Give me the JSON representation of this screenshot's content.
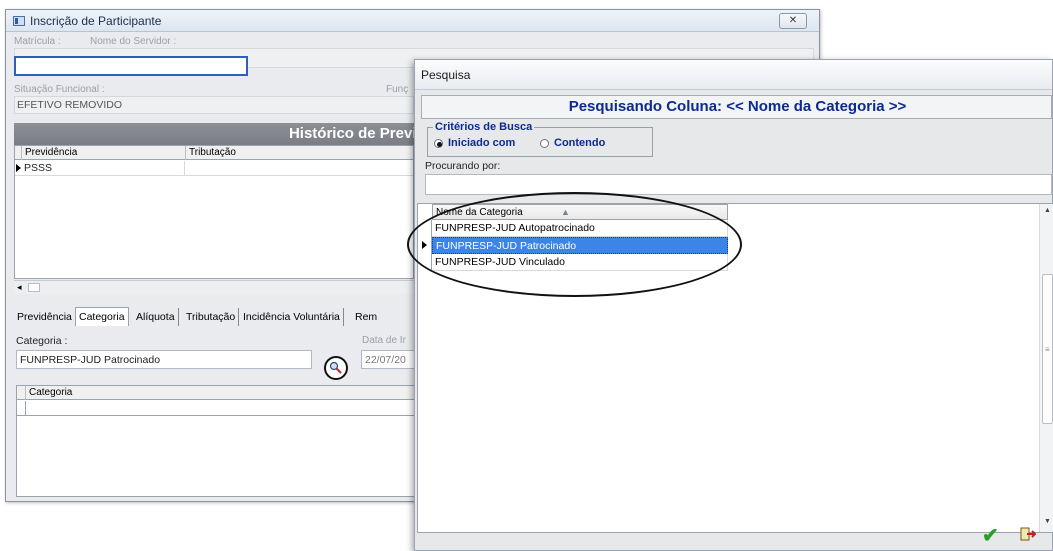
{
  "main_window": {
    "title": "Inscrição de Participante",
    "close_label": "✕",
    "labels": {
      "matricula": "Matrícula :",
      "nome_servidor": "Nome do Servidor :",
      "situacao_funcional": "Situação Funcional :",
      "funcao": "Funç"
    },
    "values": {
      "situacao_funcional": "EFETIVO REMOVIDO"
    },
    "section_title": "Histórico de Previdê",
    "history_grid": {
      "columns": [
        "Previdência",
        "Tributação"
      ],
      "rows": [
        [
          "PSSS",
          ""
        ]
      ]
    },
    "tabs": [
      "Previdência",
      "Categoria",
      "Alíquota",
      "Tributação",
      "Incidência Voluntária",
      "Rem"
    ],
    "active_tab": "Categoria",
    "categoria_label": "Categoria :",
    "categoria_value": "FUNPRESP-JUD Patrocinado",
    "data_label": "Data de Ir",
    "data_value": "22/07/20",
    "categoria_grid_header": "Categoria"
  },
  "dialog": {
    "title": "Pesquisa",
    "header": "Pesquisando Coluna: << Nome da Categoria >>",
    "criteria_legend": "Critérios de Busca",
    "options": [
      "Iniciado com",
      "Contendo"
    ],
    "selected_option": "Iniciado com",
    "search_label": "Procurando por:",
    "search_value": "",
    "list_header": "Nome da Categoria",
    "items": [
      "FUNPRESP-JUD Autopatrocinado",
      "FUNPRESP-JUD Patrocinado",
      "FUNPRESP-JUD Vinculado"
    ],
    "selected_item": "FUNPRESP-JUD Patrocinado"
  },
  "icons": [
    "window-icon",
    "close-icon",
    "search-lookup-icon",
    "sort-asc-icon",
    "confirm-check-icon",
    "exit-icon"
  ],
  "colors": {
    "selection": "#3a85e6",
    "header_blue": "#0d2a8f",
    "ok_green": "#2aa02a"
  }
}
